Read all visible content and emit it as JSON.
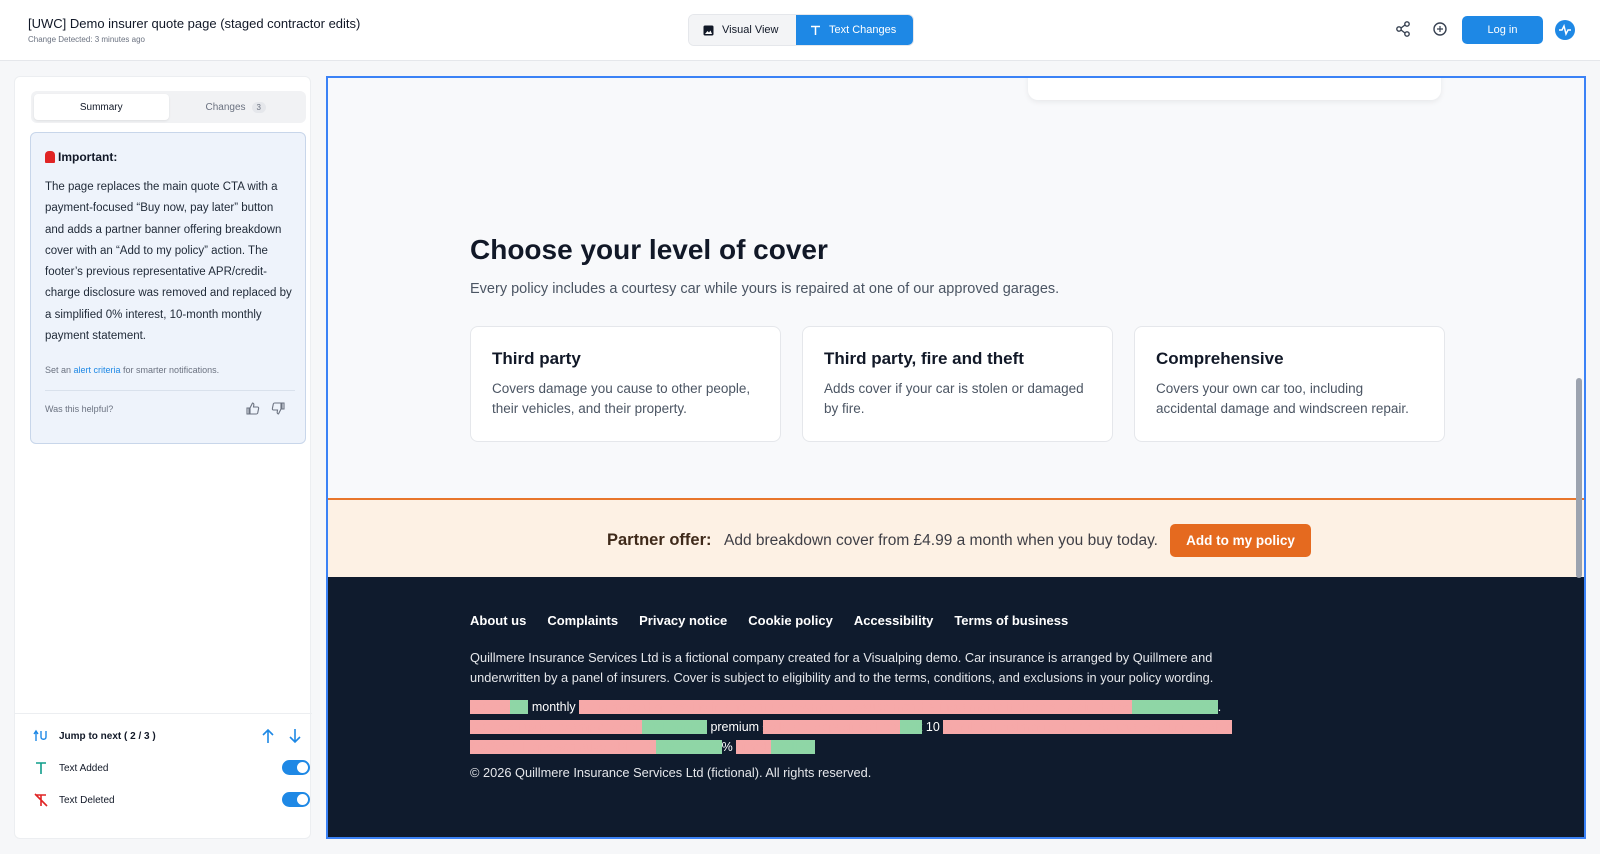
{
  "header": {
    "title": "[UWC] Demo insurer quote page (staged contractor edits)",
    "subtitle": "Change Detected: 3 minutes ago",
    "visual_view_label": "Visual View",
    "text_changes_label": "Text Changes",
    "login_label": "Log in"
  },
  "panel": {
    "tabs": [
      {
        "label": "Summary"
      },
      {
        "label": "Changes",
        "count": "3"
      }
    ],
    "summary": {
      "heading": "Important:",
      "body": "The page replaces the main quote CTA with a payment-focused “Buy now, pay later” button and adds a partner banner offering breakdown cover with an “Add to my policy” action. The footer’s previous representative APR/credit-charge disclosure was removed and replaced by a simplified 0% interest, 10-month monthly payment statement.",
      "alert_prefix": "Set an ",
      "alert_link": "alert criteria",
      "alert_suffix": " for smarter notifications.",
      "helpful": "Was this helpful?"
    },
    "jump": {
      "label": "Jump to next ( 2 / 3 )",
      "text_added": "Text Added",
      "text_deleted": "Text Deleted"
    }
  },
  "preview": {
    "cover_heading": "Choose your level of cover",
    "cover_sub": "Every policy includes a courtesy car while yours is repaired at one of our approved garages.",
    "tiers": [
      {
        "title": "Third party",
        "desc": "Covers damage you cause to other people, their vehicles, and their property."
      },
      {
        "title": "Third party, fire and theft",
        "desc": "Adds cover if your car is stolen or damaged by fire."
      },
      {
        "title": "Comprehensive",
        "desc": "Covers your own car too, including accidental damage and windscreen repair."
      }
    ],
    "partner": {
      "label": "Partner offer:",
      "text": "Add breakdown cover from £4.99 a month when you buy today.",
      "button": "Add to my policy"
    },
    "footer": {
      "links": [
        "About us",
        "Complaints",
        "Privacy notice",
        "Cookie policy",
        "Accessibility",
        "Terms of business"
      ],
      "desc": "Quillmere Insurance Services Ltd is a fictional company created for a Visualping demo. Car insurance is arranged by Quillmere and underwritten by a panel of insurers. Cover is subject to eligibility and to the terms, conditions, and exclusions in your policy wording.",
      "diff_word_monthly": "monthly",
      "diff_word_premium": "premium",
      "diff_word_10": "10",
      "diff_word_pct": "%",
      "diff_dot": ".",
      "copyright": "© 2026 Quillmere Insurance Services Ltd (fictional). All rights reserved."
    }
  },
  "colors": {
    "accent": "#1e88e5",
    "partner_bg": "#fdf1e4",
    "partner_button": "#e56a1f",
    "footer_bg": "#0f1b2d",
    "deleted_highlight": "#f6a9a9",
    "added_highlight": "#8fd6a6"
  }
}
